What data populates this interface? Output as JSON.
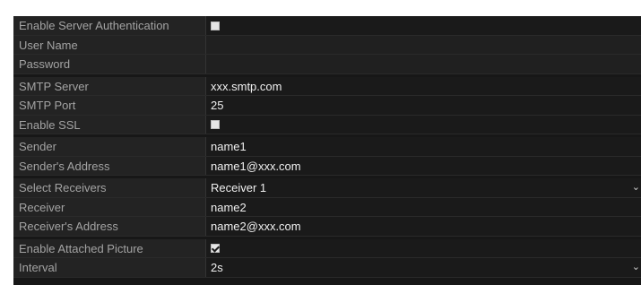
{
  "groups": [
    {
      "rows": [
        {
          "label": "Enable Server Authentication",
          "kind": "checkbox",
          "checked": false
        },
        {
          "label": "User Name",
          "kind": "empty",
          "value": ""
        },
        {
          "label": "Password",
          "kind": "empty",
          "value": ""
        }
      ]
    },
    {
      "rows": [
        {
          "label": "SMTP Server",
          "kind": "text",
          "value": "xxx.smtp.com"
        },
        {
          "label": "SMTP Port",
          "kind": "text",
          "value": "25"
        },
        {
          "label": "Enable SSL",
          "kind": "checkbox",
          "checked": false
        }
      ]
    },
    {
      "rows": [
        {
          "label": "Sender",
          "kind": "text",
          "value": "name1"
        },
        {
          "label": "Sender's Address",
          "kind": "text",
          "value": "name1@xxx.com"
        }
      ]
    },
    {
      "rows": [
        {
          "label": "Select Receivers",
          "kind": "select",
          "value": "Receiver 1"
        },
        {
          "label": "Receiver",
          "kind": "text",
          "value": "name2"
        },
        {
          "label": "Receiver's Address",
          "kind": "text",
          "value": "name2@xxx.com"
        }
      ]
    },
    {
      "rows": [
        {
          "label": "Enable Attached Picture",
          "kind": "checkbox",
          "checked": true
        },
        {
          "label": "Interval",
          "kind": "select",
          "value": "2s"
        }
      ]
    }
  ],
  "icons": {
    "dropdown": "chevron-down-icon",
    "checkbox": "checkbox-icon"
  },
  "colors": {
    "panel_bg": "#171717",
    "label_text": "#a3a3a3",
    "value_text": "#f0f0f0"
  }
}
